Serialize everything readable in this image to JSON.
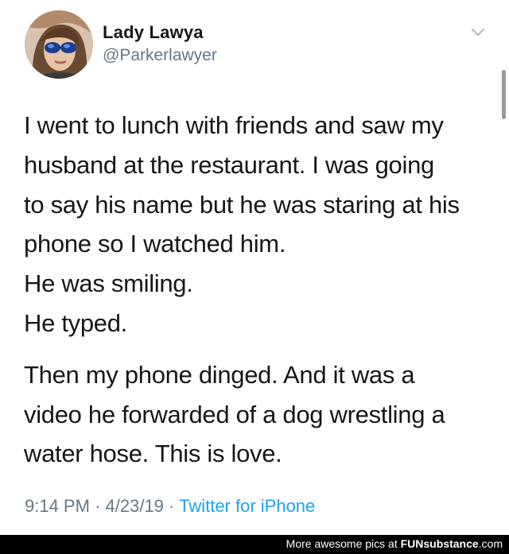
{
  "tweet": {
    "author_name": "Lady Lawya",
    "author_handle": "@Parkerlawyer",
    "lines_p1": [
      "I went to lunch with friends and saw my",
      "husband at the restaurant. I was going",
      "to say his name but he was staring at his",
      "phone so I watched him.",
      "He was smiling.",
      "He typed."
    ],
    "lines_p2": [
      "Then my phone dinged. And it was a",
      "video he forwarded of a dog wrestling a",
      "water hose. This is love."
    ],
    "time": "9:14 PM",
    "date": "4/23/19",
    "separator": "·",
    "source": "Twitter for iPhone"
  },
  "footer": {
    "text_prefix": "More awesome pics at ",
    "brand": "FUNsubstance",
    "domain": ".com"
  },
  "icons": {
    "menu": "chevron-down-icon"
  },
  "colors": {
    "text": "#14171a",
    "secondary": "#657786",
    "link": "#1da1f2",
    "footer_bg": "#000000"
  }
}
